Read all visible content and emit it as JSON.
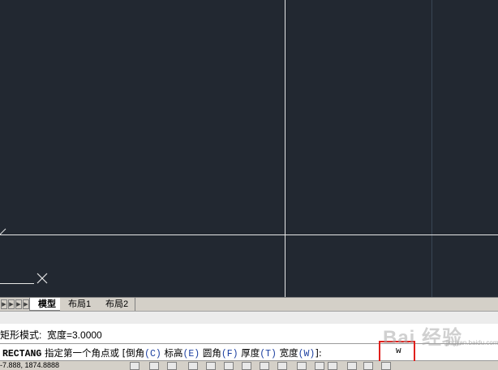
{
  "layout_tabs": [
    {
      "label": "模型",
      "active": true
    },
    {
      "label": "布局1",
      "active": false
    },
    {
      "label": "布局2",
      "active": false
    }
  ],
  "command": {
    "history": "矩形模式:  宽度=3.0000",
    "prompt_cmd": "RECTANG",
    "prompt_text": " 指定第一个角点或 [",
    "options": [
      {
        "label": "倒角",
        "key": "(C)"
      },
      {
        "label": "标高",
        "key": "(E)"
      },
      {
        "label": "圆角",
        "key": "(F)"
      },
      {
        "label": "厚度",
        "key": "(T)"
      },
      {
        "label": "宽度",
        "key": "(W)"
      }
    ],
    "prompt_end": "]:",
    "input_value": "w"
  },
  "watermark": {
    "brand": "Bai 经验",
    "url": "jingyan.baidu.com"
  },
  "status": {
    "coords": "-7.888, 1874.8888"
  },
  "colors": {
    "canvas": "#222831",
    "highlight": "#e0201c",
    "option": "#1a3ea0"
  }
}
